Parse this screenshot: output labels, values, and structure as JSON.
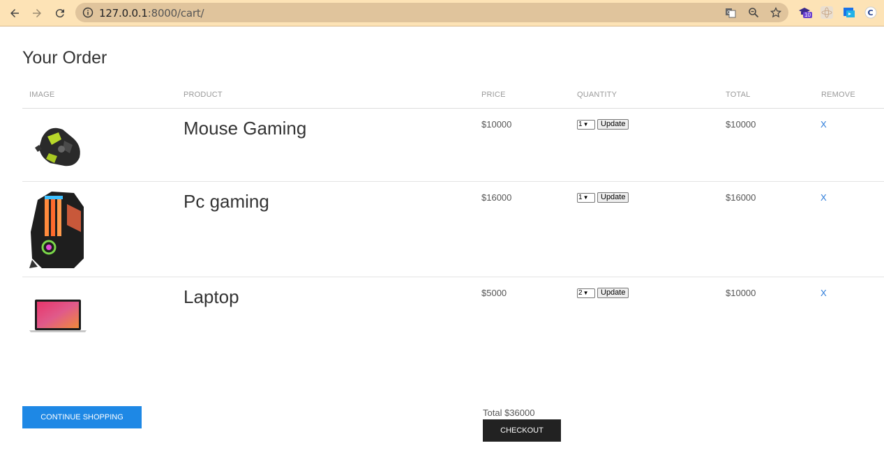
{
  "browser": {
    "url_host": "127.0.0.1",
    "url_path": ":8000/cart/",
    "extension_badge": "10"
  },
  "page": {
    "title": "Your Order"
  },
  "table": {
    "headers": {
      "image": "IMAGE",
      "product": "PRODUCT",
      "price": "PRICE",
      "quantity": "QUANTITY",
      "total": "TOTAL",
      "remove": "REMOVE"
    },
    "rows": [
      {
        "product": "Mouse Gaming",
        "price": "$10000",
        "quantity": "1",
        "update_label": "Update",
        "total": "$10000",
        "remove_label": "X",
        "image": "gaming-mouse-image"
      },
      {
        "product": "Pc gaming",
        "price": "$16000",
        "quantity": "1",
        "update_label": "Update",
        "total": "$16000",
        "remove_label": "X",
        "image": "gaming-pc-image"
      },
      {
        "product": "Laptop",
        "price": "$5000",
        "quantity": "2",
        "update_label": "Update",
        "total": "$10000",
        "remove_label": "X",
        "image": "laptop-image"
      }
    ]
  },
  "footer": {
    "continue_label": "CONTINUE SHOPPING",
    "total_text": "Total $36000",
    "checkout_label": "CHECKOUT"
  },
  "colors": {
    "chrome_bg": "#fde3b6",
    "continue_btn": "#1e88e5",
    "checkout_btn": "#222222",
    "remove_link": "#2b7bd9"
  }
}
